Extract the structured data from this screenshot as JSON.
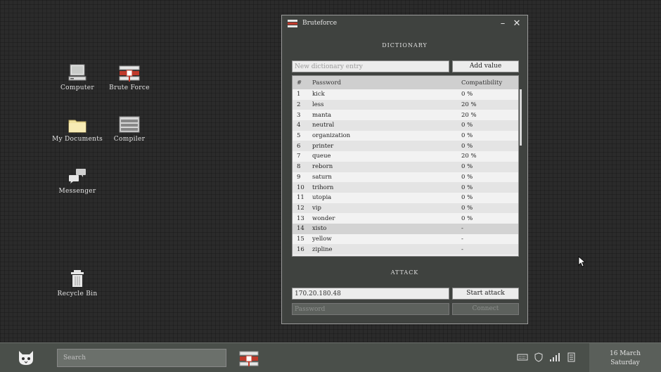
{
  "desktop": {
    "icons": [
      {
        "label": "Computer",
        "icon": "computer-icon"
      },
      {
        "label": "Brute Force",
        "icon": "bruteforce-icon"
      },
      {
        "label": "My Documents",
        "icon": "folder-icon"
      },
      {
        "label": "Compiler",
        "icon": "compiler-icon"
      },
      {
        "label": "Messenger",
        "icon": "messenger-icon"
      },
      {
        "label": "Recycle Bin",
        "icon": "recycle-bin-icon"
      }
    ]
  },
  "window": {
    "title": "Bruteforce",
    "minimize": "–",
    "close": "✕",
    "dictionary": {
      "section_title": "DICTIONARY",
      "entry_placeholder": "New dictionary entry",
      "add_label": "Add value",
      "columns": [
        "#",
        "Password",
        "Compatibility"
      ],
      "rows": [
        {
          "num": "1",
          "password": "kick",
          "compat": "0 %"
        },
        {
          "num": "2",
          "password": "less",
          "compat": "20 %"
        },
        {
          "num": "3",
          "password": "manta",
          "compat": "20 %"
        },
        {
          "num": "4",
          "password": "neutral",
          "compat": "0 %"
        },
        {
          "num": "5",
          "password": "organization",
          "compat": "0 %"
        },
        {
          "num": "6",
          "password": "printer",
          "compat": "0 %"
        },
        {
          "num": "7",
          "password": "queue",
          "compat": "20 %"
        },
        {
          "num": "8",
          "password": "reborn",
          "compat": "0 %"
        },
        {
          "num": "9",
          "password": "saturn",
          "compat": "0 %"
        },
        {
          "num": "10",
          "password": "trihorn",
          "compat": "0 %"
        },
        {
          "num": "11",
          "password": "utopia",
          "compat": "0 %"
        },
        {
          "num": "12",
          "password": "vip",
          "compat": "0 %"
        },
        {
          "num": "13",
          "password": "wonder",
          "compat": "0 %"
        },
        {
          "num": "14",
          "password": "xisto",
          "compat": "-"
        },
        {
          "num": "15",
          "password": "yellow",
          "compat": "-"
        },
        {
          "num": "16",
          "password": "zipline",
          "compat": "-"
        }
      ]
    },
    "attack": {
      "section_title": "ATTACK",
      "ip_value": "170.20.180.48",
      "start_label": "Start attack",
      "password_placeholder": "Password",
      "connect_label": "Connect"
    }
  },
  "taskbar": {
    "search_placeholder": "Search",
    "logo_icon": "cat-logo-icon",
    "tray_icons": [
      "keyboard-icon",
      "shield-icon",
      "signal-icon",
      "document-icon"
    ],
    "date": "16 March",
    "day": "Saturday"
  }
}
